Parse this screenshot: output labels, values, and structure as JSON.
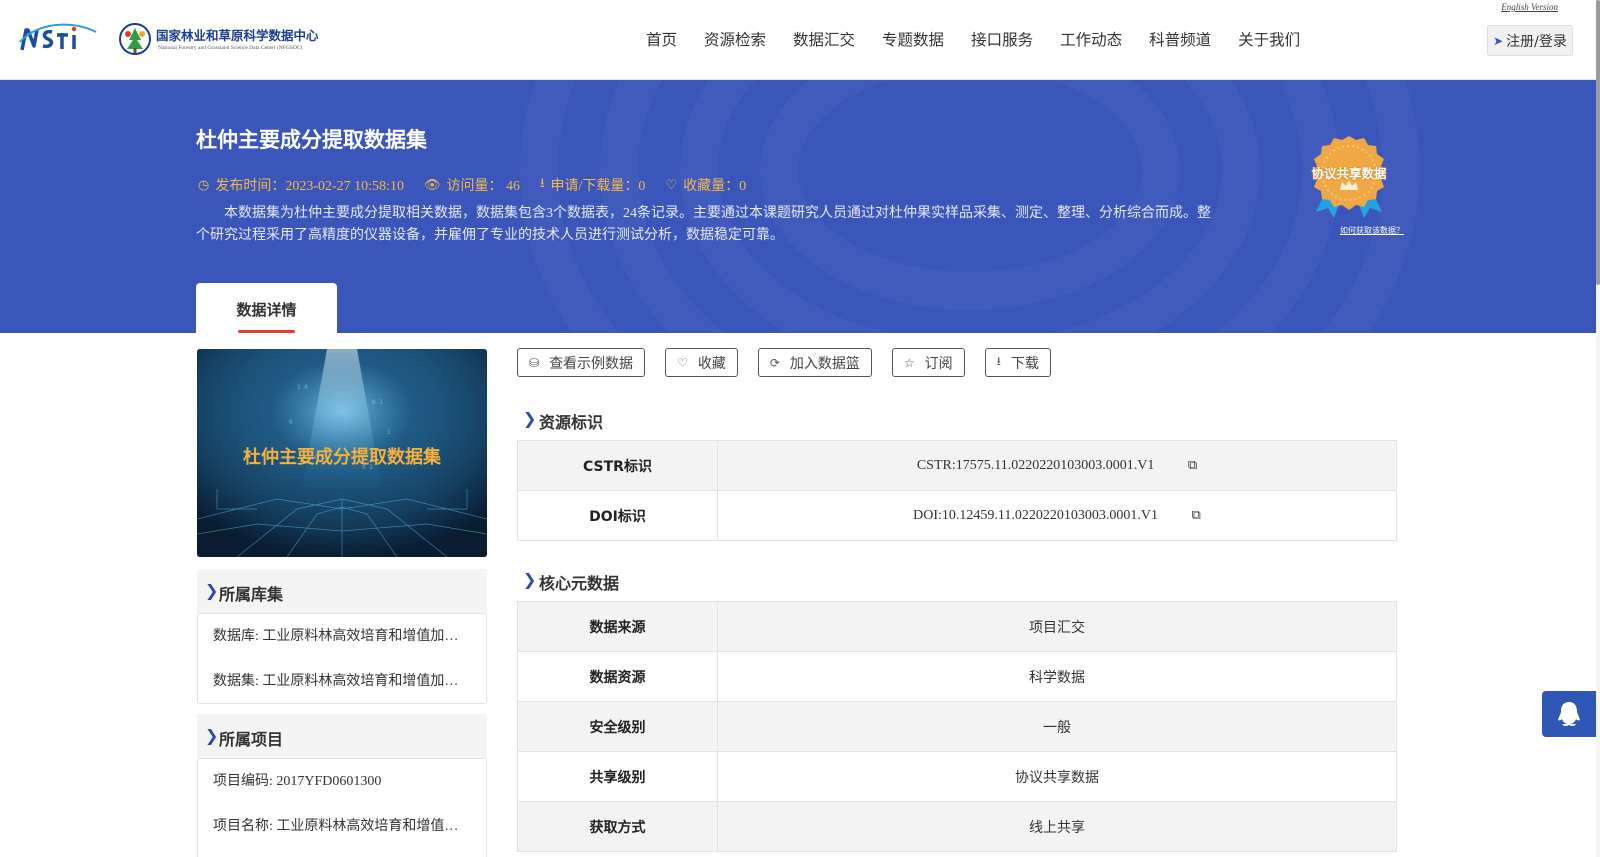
{
  "header": {
    "logo_cn": "国家林业和草原科学数据中心",
    "logo_en": "National Forestry and Grassland Science Data Center (NFGSDC)",
    "nav": [
      "首页",
      "资源检索",
      "数据汇交",
      "专题数据",
      "接口服务",
      "工作动态",
      "科普频道",
      "关于我们"
    ],
    "english_link": "English Version",
    "login_label": "注册/登录"
  },
  "banner": {
    "title": "杜仲主要成分提取数据集",
    "publish_time": "发布时间：2023-02-27 10:58:10",
    "visits": "访问量： 46",
    "downloads": "申请/下载量：0",
    "favorites": "收藏量：0",
    "description": "本数据集为杜仲主要成分提取相关数据，数据集包含3个数据表，24条记录。主要通过本课题研究人员通过对杜仲果实样品采集、测定、整理、分析综合而成。整个研究过程采用了高精度的仪器设备，并雇佣了专业的技术人员进行测试分析，数据稳定可靠。",
    "badge_text": "协议共享数据",
    "badge_link": "如何获取该数据？",
    "tab_label": "数据详情"
  },
  "left": {
    "cover_title": "杜仲主要成分提取数据集",
    "library_heading": "所属库集",
    "library_items": [
      "数据库: 工业原料林高效培育和增值加工技术研究",
      "数据集: 工业原料林高效培育和增值加工技术研究"
    ],
    "project_heading": "所属项目",
    "project_items": [
      "项目编码: 2017YFD0601300",
      "项目名称: 工业原料林高效培育和增值加工技术研究"
    ]
  },
  "actions": [
    "查看示例数据",
    "收藏",
    "加入数据篮",
    "订阅",
    "下载"
  ],
  "resource_id": {
    "heading": "资源标识",
    "rows": [
      {
        "key": "CSTR标识",
        "value": "CSTR:17575.11.0220220103003.0001.V1"
      },
      {
        "key": "DOI标识",
        "value": "DOI:10.12459.11.0220220103003.0001.V1"
      }
    ]
  },
  "core_meta": {
    "heading": "核心元数据",
    "rows": [
      {
        "key": "数据来源",
        "value": "项目汇交"
      },
      {
        "key": "数据资源",
        "value": "科学数据"
      },
      {
        "key": "安全级别",
        "value": "一般"
      },
      {
        "key": "共享级别",
        "value": "协议共享数据"
      },
      {
        "key": "获取方式",
        "value": "线上共享"
      }
    ]
  },
  "colors": {
    "banner": "#3a56ba",
    "accent_gold": "#f5b94a",
    "tab_underline": "#e4402c",
    "chevron": "#2c4da6"
  }
}
